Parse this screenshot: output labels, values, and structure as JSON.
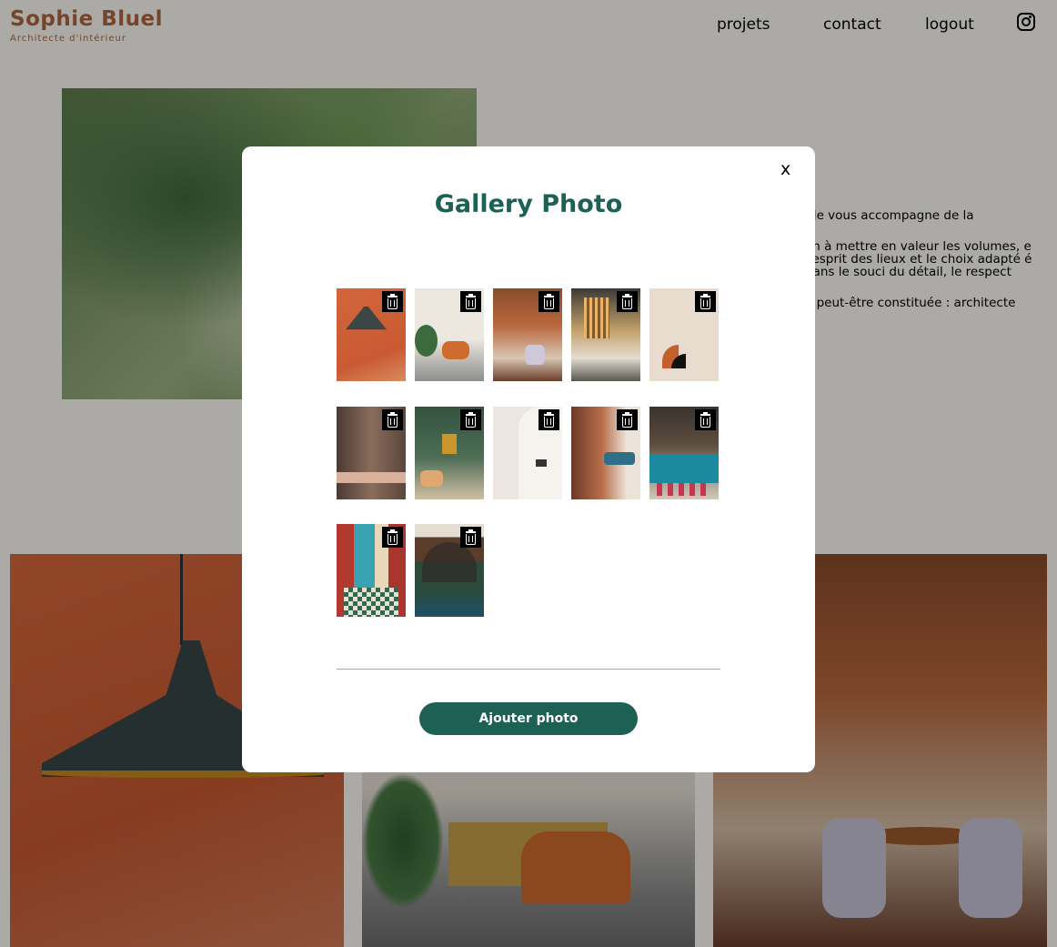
{
  "header": {
    "logo_name": "Sophie Bluel",
    "logo_subtitle": "Architecte d'intérieur",
    "nav": [
      {
        "label": "projets"
      },
      {
        "label": "contact"
      },
      {
        "label": "logout"
      }
    ],
    "social_icon": "instagram-icon"
  },
  "intro": {
    "paragraphs": [
      ". Je vous accompagne de la",
      "on à mettre en valeur les volumes, e l'esprit des lieux et le choix adapté é dans le souci du détail, le respect",
      "e peut-être constituée : architecte"
    ]
  },
  "modal": {
    "close_label": "x",
    "title": "Gallery Photo",
    "add_button_label": "Ajouter photo",
    "delete_icon": "trash-icon",
    "photo_count": 12
  },
  "colors": {
    "brand": "#b1663c",
    "accent": "#1d6154",
    "overlay": "rgba(0,0,0,0.33)"
  }
}
